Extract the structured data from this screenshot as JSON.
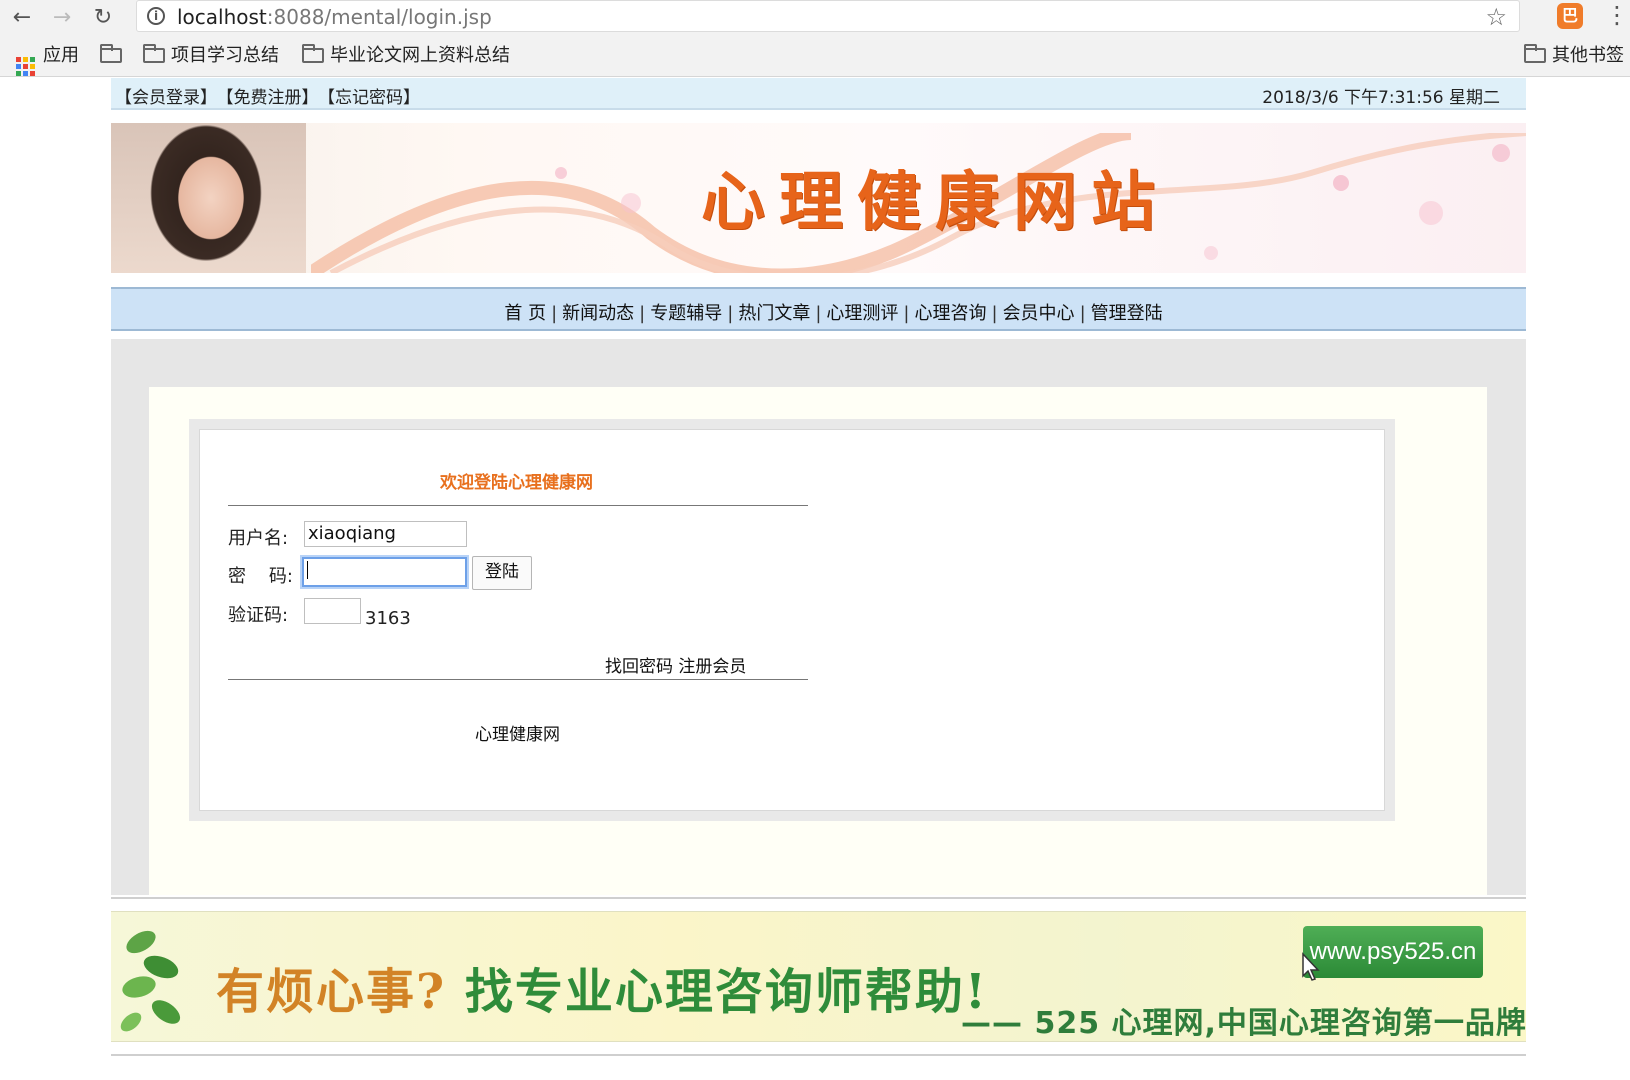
{
  "browser": {
    "url_host": "localhost",
    "url_rest": ":8088/mental/login.jsp",
    "bookmarks": {
      "apps": "应用",
      "folder1": "项目学习总结",
      "folder2": "毕业论文网上资料总结",
      "other": "其他书签"
    },
    "icons": [
      "back-arrow-icon",
      "forward-arrow-icon",
      "reload-icon",
      "info-icon",
      "star-icon",
      "extension-icon",
      "menu-dots-icon",
      "folder-icon",
      "apps-grid-icon"
    ]
  },
  "topbar": {
    "member_login": "【会员登录】",
    "register": "【免费注册】",
    "forgot": "【忘记密码】",
    "datetime": "2018/3/6 下午7:31:56  星期二"
  },
  "banner": {
    "title": "心理健康网站"
  },
  "nav": {
    "items": [
      "首 页",
      "新闻动态",
      "专题辅导",
      "热门文章",
      "心理测评",
      "心理咨询",
      "会员中心",
      "管理登陆"
    ]
  },
  "login": {
    "welcome": "欢迎登陆心理健康网",
    "username_label": "用户名:",
    "username_value": "xiaoqiang",
    "password_label": "密    码:",
    "password_value": "",
    "captcha_label": "验证码:",
    "captcha_value": "",
    "captcha_code": "3163",
    "login_button": "登陆",
    "find_password": "找回密码",
    "register_member": "注册会员",
    "footer_name": "心理健康网"
  },
  "ad": {
    "headline_part1": "有烦心事?",
    "headline_part2": "找专业心理咨询师帮助!",
    "url": "www.psy525.cn",
    "tagline": "—— 525 心理网,中国心理咨询第一品牌!"
  },
  "colors": {
    "accent_orange": "#e8701e",
    "nav_bg": "#cde2f6",
    "topbar_bg": "#dff0f9",
    "ad_green": "#2f8c3a"
  }
}
